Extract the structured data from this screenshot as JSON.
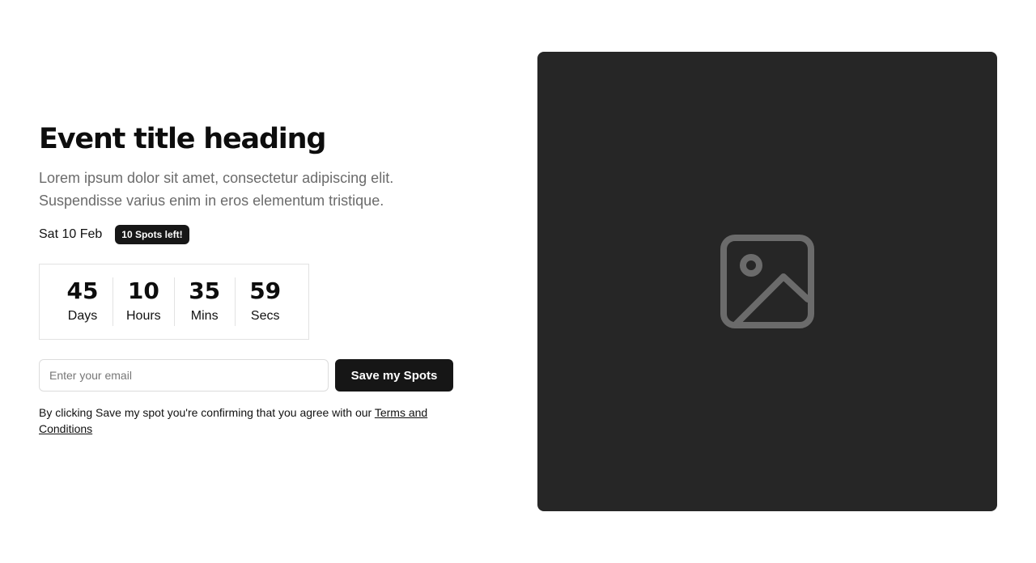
{
  "event": {
    "title": "Event title heading",
    "description": "Lorem ipsum dolor sit amet, consectetur adipiscing elit. Suspendisse varius enim in eros elementum tristique.",
    "date": "Sat 10 Feb",
    "spots_badge": "10 Spots left!"
  },
  "countdown": [
    {
      "value": "45",
      "label": "Days"
    },
    {
      "value": "10",
      "label": "Hours"
    },
    {
      "value": "35",
      "label": "Mins"
    },
    {
      "value": "59",
      "label": "Secs"
    }
  ],
  "form": {
    "email_placeholder": "Enter your email",
    "email_value": "",
    "submit_label": "Save my Spots"
  },
  "disclaimer": {
    "text": "By clicking Save my spot you're confirming that you agree with our ",
    "link_text": "Terms and Conditions"
  },
  "media": {
    "icon": "image-placeholder-icon",
    "background_color": "#262626",
    "icon_color": "#6b6b6b"
  }
}
